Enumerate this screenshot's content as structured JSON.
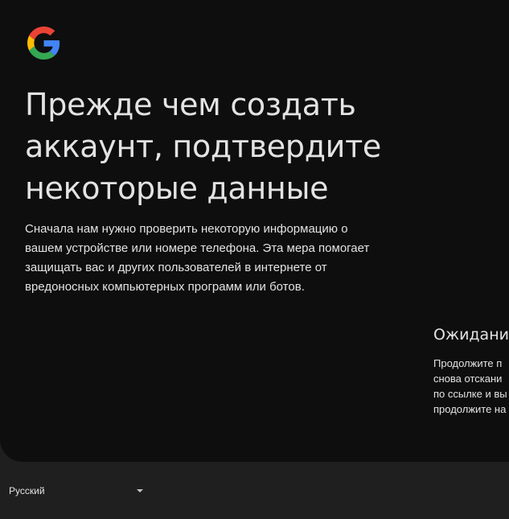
{
  "headline": {
    "line1": "Прежде чем создать",
    "line2": "аккаунт, подтвердите",
    "line3": "некоторые данные"
  },
  "intro": {
    "line1": "Сначала нам нужно проверить некоторую информацию о",
    "line2": "вашем устройстве или номере телефона. Эта мера помогает",
    "line3": "защищать вас и других пользователей в интернете от",
    "line4": "вредоносных компьютерных программ или ботов."
  },
  "right_panel": {
    "title": "Ожидание",
    "lines": [
      "Продолжите п",
      "снова отскани",
      "по ссылке и вы",
      "продолжите на"
    ]
  },
  "footer": {
    "language": "Русский"
  },
  "colors": {
    "card_bg": "#0e0e0f",
    "page_bg": "#1f1f1f",
    "text": "#e3e3e3",
    "google_blue": "#4285F4",
    "google_red": "#EA4335",
    "google_yellow": "#FBBC05",
    "google_green": "#34A853"
  },
  "icons": {
    "logo": "google-g-logo",
    "language_caret": "caret-down-icon"
  }
}
